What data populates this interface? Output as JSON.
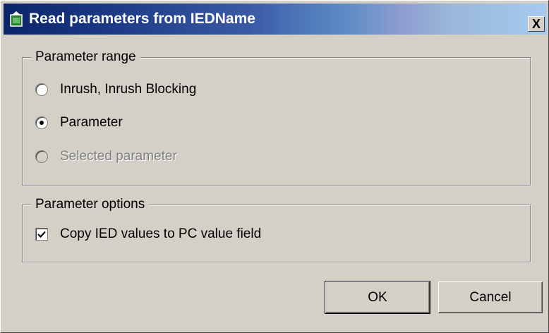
{
  "window": {
    "title": "Read parameters from IEDName",
    "close_symbol": "X",
    "icon": "app-icon"
  },
  "parameter_range": {
    "legend": "Parameter range",
    "options": [
      {
        "label": "Inrush, Inrush Blocking",
        "checked": false,
        "enabled": true
      },
      {
        "label": "Parameter",
        "checked": true,
        "enabled": true
      },
      {
        "label": "Selected parameter",
        "checked": false,
        "enabled": false
      }
    ]
  },
  "parameter_options": {
    "legend": "Parameter options",
    "copy_label": "Copy IED values to PC value field",
    "copy_checked": true
  },
  "buttons": {
    "ok": "OK",
    "cancel": "Cancel"
  }
}
